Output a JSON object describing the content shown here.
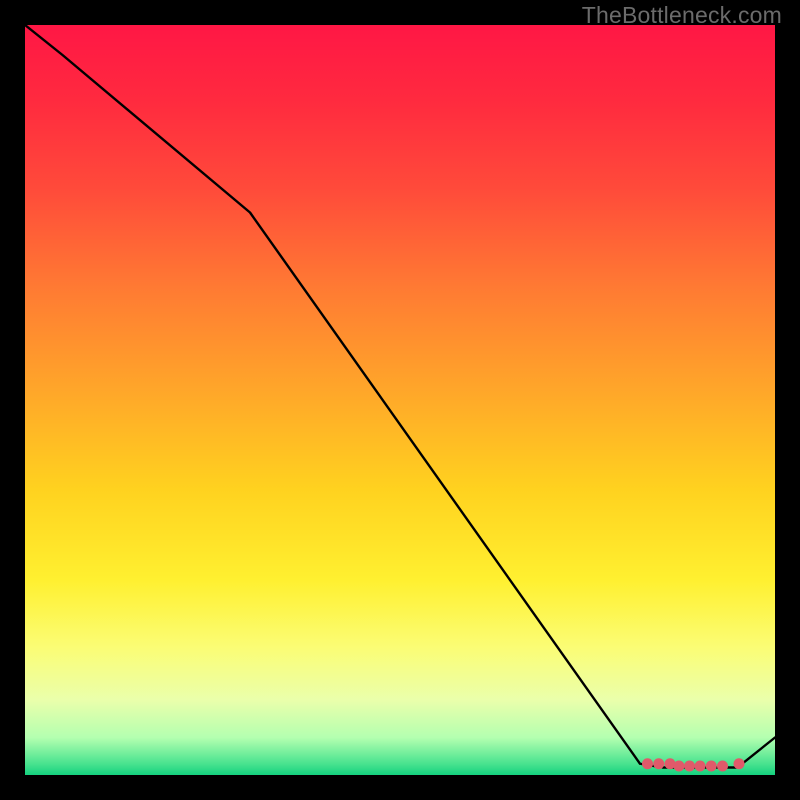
{
  "watermark": "TheBottleneck.com",
  "chart_data": {
    "type": "line",
    "title": "",
    "xlabel": "",
    "ylabel": "",
    "xlim": [
      0,
      100
    ],
    "ylim": [
      0,
      100
    ],
    "grid": false,
    "legend": false,
    "series": [
      {
        "name": "curve",
        "x": [
          0,
          5,
          30,
          82,
          85,
          95,
          100
        ],
        "values": [
          100,
          96,
          75,
          1.5,
          1,
          1,
          5
        ]
      }
    ],
    "markers": [
      {
        "x": 83.0,
        "y": 1.5
      },
      {
        "x": 84.5,
        "y": 1.5
      },
      {
        "x": 86.0,
        "y": 1.5
      },
      {
        "x": 87.2,
        "y": 1.2
      },
      {
        "x": 88.6,
        "y": 1.2
      },
      {
        "x": 90.0,
        "y": 1.2
      },
      {
        "x": 91.5,
        "y": 1.2
      },
      {
        "x": 93.0,
        "y": 1.2
      },
      {
        "x": 95.2,
        "y": 1.5
      }
    ],
    "gradient_stops": [
      {
        "offset": 0.0,
        "color": "#ff1745"
      },
      {
        "offset": 0.1,
        "color": "#ff2a3f"
      },
      {
        "offset": 0.22,
        "color": "#ff4b3a"
      },
      {
        "offset": 0.35,
        "color": "#ff7a33"
      },
      {
        "offset": 0.48,
        "color": "#ffa42a"
      },
      {
        "offset": 0.62,
        "color": "#ffd21f"
      },
      {
        "offset": 0.74,
        "color": "#fff030"
      },
      {
        "offset": 0.83,
        "color": "#fbfd75"
      },
      {
        "offset": 0.9,
        "color": "#eaffab"
      },
      {
        "offset": 0.95,
        "color": "#b4ffb0"
      },
      {
        "offset": 0.985,
        "color": "#49e38f"
      },
      {
        "offset": 1.0,
        "color": "#15d17f"
      }
    ],
    "marker_color": "#e05a6a",
    "line_color": "#000000"
  }
}
